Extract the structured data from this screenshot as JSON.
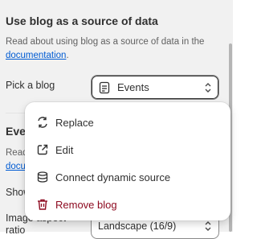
{
  "section": {
    "title": "Use blog as a source of data",
    "desc_prefix": "Read about using blog as a source of data in the ",
    "desc_link": "documentation",
    "desc_suffix": "."
  },
  "pick": {
    "label": "Pick a blog",
    "value": "Events",
    "icon": "document-icon"
  },
  "background": {
    "heading": "Eve",
    "desc_line1": "Read",
    "desc_link": "docu",
    "show_label": "Show",
    "aspect_label": "Image aspect ratio",
    "aspect_value": "Landscape (16/9)"
  },
  "menu": {
    "items": [
      {
        "label": "Replace",
        "icon": "replace-icon"
      },
      {
        "label": "Edit",
        "icon": "external-link-icon"
      },
      {
        "label": "Connect dynamic source",
        "icon": "database-icon"
      },
      {
        "label": "Remove blog",
        "icon": "trash-icon"
      }
    ]
  },
  "colors": {
    "accent_link": "#005bd3",
    "danger": "#8e0b21",
    "panel_bg": "#f1f1f1"
  }
}
